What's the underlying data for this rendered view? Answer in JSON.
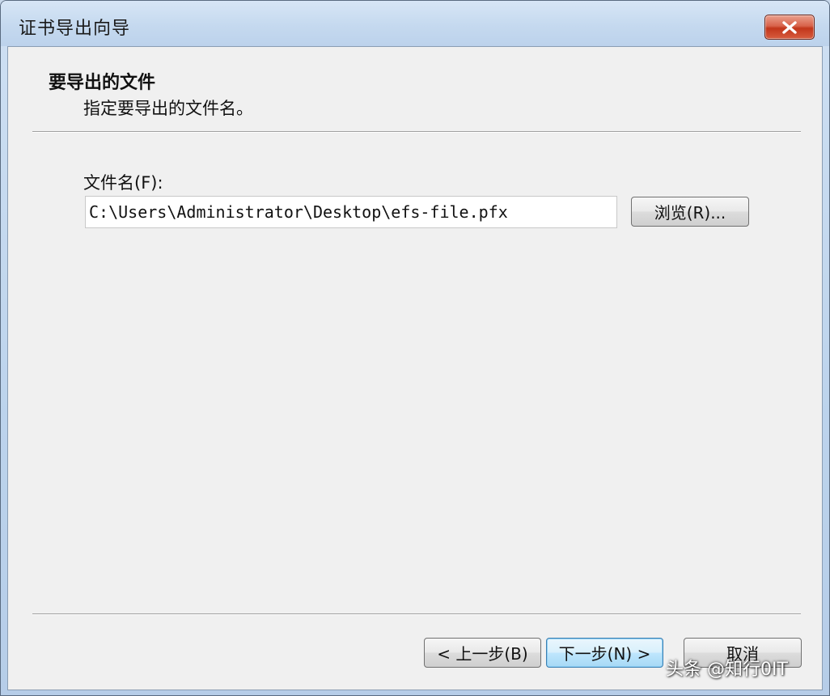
{
  "window": {
    "title": "证书导出向导",
    "close_icon": "close-icon"
  },
  "header": {
    "title": "要导出的文件",
    "subtitle": "指定要导出的文件名。"
  },
  "form": {
    "file_label": "文件名(F):",
    "file_value": "C:\\Users\\Administrator\\Desktop\\efs-file.pfx",
    "browse_label": "浏览(R)..."
  },
  "footer": {
    "back_label": "< 上一步(B)",
    "next_label": "下一步(N) >",
    "cancel_label": "取消"
  },
  "watermark": {
    "text": "头条 @知行0IT"
  },
  "colors": {
    "close_button": "#c2361b",
    "client_background": "#f0f0f0",
    "default_button_border": "#3c7fb1"
  }
}
